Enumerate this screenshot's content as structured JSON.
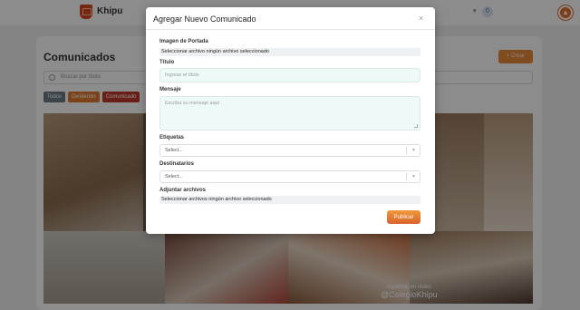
{
  "app": {
    "brand": "Khipu"
  },
  "topbar": {
    "badge": "0"
  },
  "page": {
    "title": "Comunicados",
    "create_label": "+ Crear",
    "search_placeholder": "Buscar por título",
    "chips": [
      {
        "label": "Todos",
        "color": "#6c7a89"
      },
      {
        "label": "Dividendo",
        "color": "#e07b2a"
      },
      {
        "label": "Comunicado",
        "color": "#c0392b"
      }
    ]
  },
  "gallery": {
    "watermark_line1": "síguenos en redes",
    "watermark_line2": "@ColegioKhipu"
  },
  "modal": {
    "title": "Agregar Nuevo Comunicado",
    "close": "×",
    "cover_label": "Imagen de Portada",
    "cover_value": "Seleccionar archivo ningún archivo seleccionado",
    "title_label": "Título",
    "title_placeholder": "Ingrese el título",
    "message_label": "Mensaje",
    "message_placeholder": "Escriba su mensaje aquí",
    "tags_label": "Etiquetas",
    "tags_value": "Select...",
    "recipients_label": "Destinatarios",
    "recipients_value": "Select...",
    "attach_label": "Adjuntar archivos",
    "attach_value": "Seleccionar archivos ningún archivo seleccionado",
    "submit_label": "Publicar"
  },
  "colors": {
    "accent": "#e8893a",
    "submit_gradient_top": "#f09a3e",
    "submit_gradient_bottom": "#d8622a"
  }
}
